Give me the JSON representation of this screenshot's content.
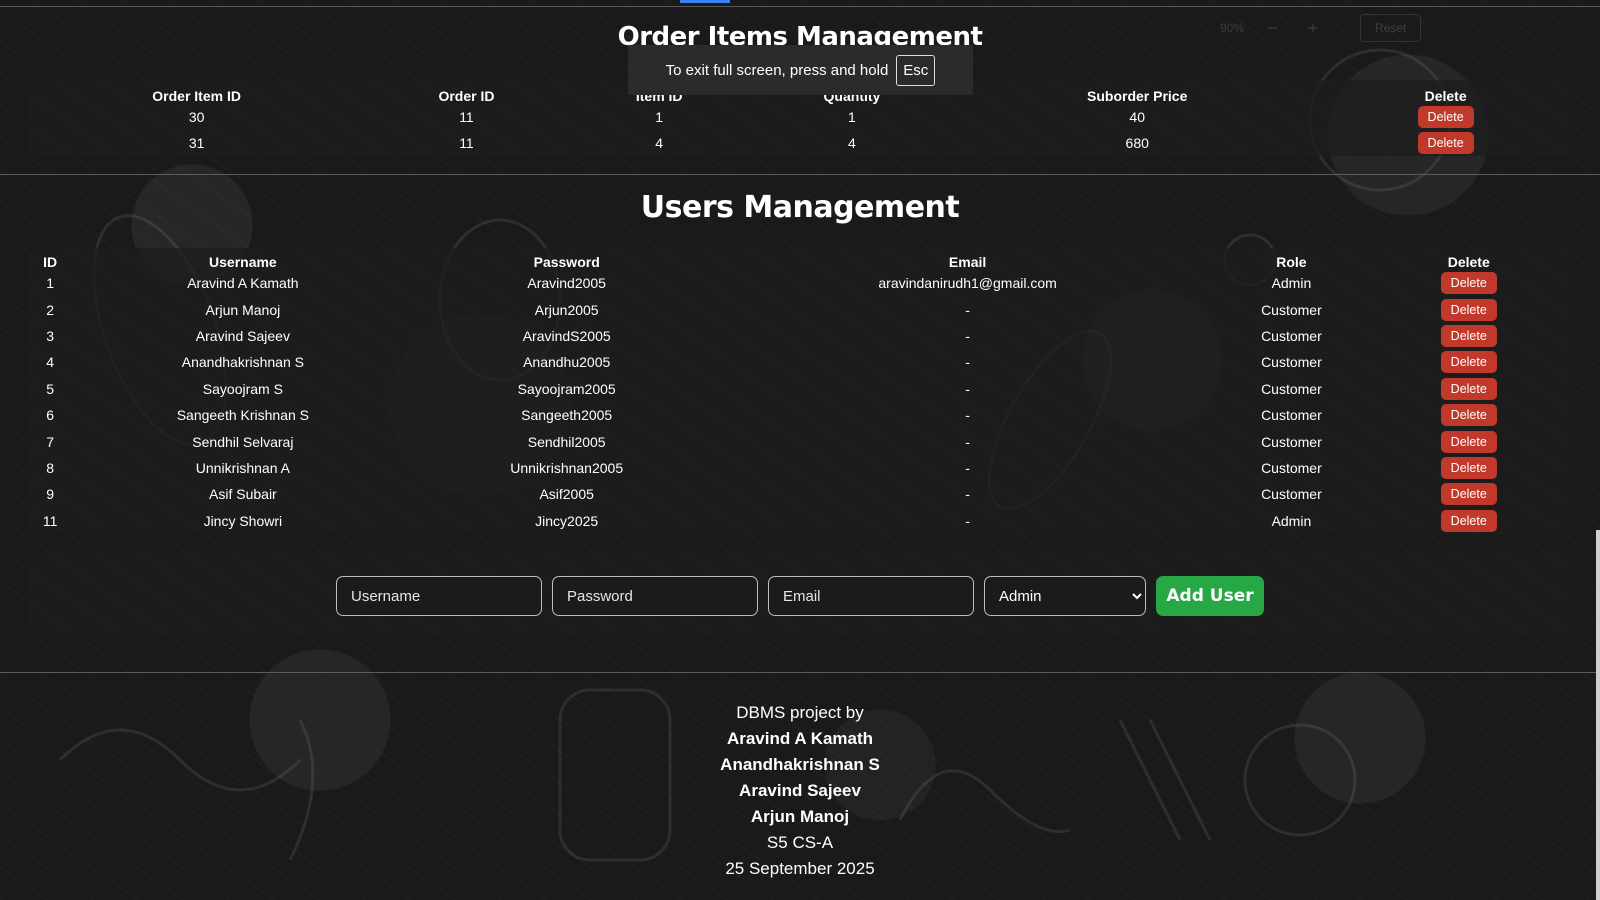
{
  "order_section": {
    "title": "Order Items Management",
    "columns": [
      "Order Item ID",
      "Order ID",
      "Item ID",
      "Quantity",
      "Suborder Price",
      "Delete"
    ],
    "rows": [
      {
        "order_item_id": "30",
        "order_id": "11",
        "item_id": "1",
        "quantity": "1",
        "suborder_price": "40",
        "delete_label": "Delete"
      },
      {
        "order_item_id": "31",
        "order_id": "11",
        "item_id": "4",
        "quantity": "4",
        "suborder_price": "680",
        "delete_label": "Delete"
      }
    ]
  },
  "fullscreen_toast": {
    "text": "To exit full screen, press and hold",
    "key": "Esc"
  },
  "zoom": {
    "level": "90%",
    "minus": "−",
    "plus": "+",
    "reset": "Reset"
  },
  "users_section": {
    "title": "Users Management",
    "columns": [
      "ID",
      "Username",
      "Password",
      "Email",
      "Role",
      "Delete"
    ],
    "rows": [
      {
        "id": "1",
        "username": "Aravind A Kamath",
        "password": "Aravind2005",
        "email": "aravindanirudh1@gmail.com",
        "role": "Admin",
        "delete_label": "Delete"
      },
      {
        "id": "2",
        "username": "Arjun Manoj",
        "password": "Arjun2005",
        "email": "-",
        "role": "Customer",
        "delete_label": "Delete"
      },
      {
        "id": "3",
        "username": "Aravind Sajeev",
        "password": "AravindS2005",
        "email": "-",
        "role": "Customer",
        "delete_label": "Delete"
      },
      {
        "id": "4",
        "username": "Anandhakrishnan S",
        "password": "Anandhu2005",
        "email": "-",
        "role": "Customer",
        "delete_label": "Delete"
      },
      {
        "id": "5",
        "username": "Sayoojram S",
        "password": "Sayoojram2005",
        "email": "-",
        "role": "Customer",
        "delete_label": "Delete"
      },
      {
        "id": "6",
        "username": "Sangeeth Krishnan S",
        "password": "Sangeeth2005",
        "email": "-",
        "role": "Customer",
        "delete_label": "Delete"
      },
      {
        "id": "7",
        "username": "Sendhil Selvaraj",
        "password": "Sendhil2005",
        "email": "-",
        "role": "Customer",
        "delete_label": "Delete"
      },
      {
        "id": "8",
        "username": "Unnikrishnan A",
        "password": "Unnikrishnan2005",
        "email": "-",
        "role": "Customer",
        "delete_label": "Delete"
      },
      {
        "id": "9",
        "username": "Asif Subair",
        "password": "Asif2005",
        "email": "-",
        "role": "Customer",
        "delete_label": "Delete"
      },
      {
        "id": "11",
        "username": "Jincy Showri",
        "password": "Jincy2025",
        "email": "-",
        "role": "Admin",
        "delete_label": "Delete"
      }
    ]
  },
  "add_user_form": {
    "username_placeholder": "Username",
    "password_placeholder": "Password",
    "email_placeholder": "Email",
    "role_selected": "Admin",
    "submit_label": "Add User"
  },
  "footer": {
    "intro": "DBMS project by",
    "authors": [
      "Aravind A Kamath",
      "Anandhakrishnan S",
      "Aravind Sajeev",
      "Arjun Manoj"
    ],
    "class": "S5 CS-A",
    "date": "25 September 2025"
  },
  "colors": {
    "delete": "#c0392b",
    "add": "#28a745",
    "background": "#1a1a1a"
  }
}
